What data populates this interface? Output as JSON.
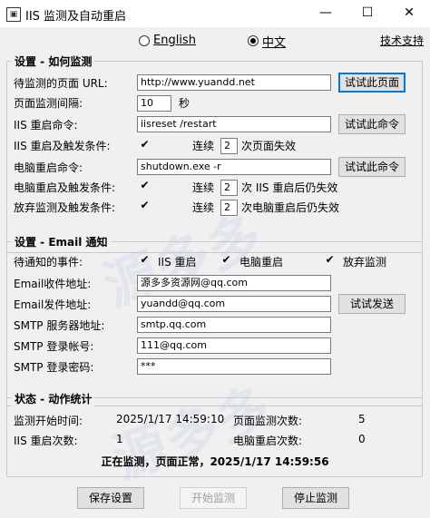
{
  "window": {
    "title": "IIS 监测及自动重启",
    "icon_name": "app-icon",
    "minimize_glyph": "—",
    "maximize_glyph": "☐",
    "close_glyph": "✕"
  },
  "language": {
    "english_label": "English",
    "chinese_label": "中文",
    "selected": "中文",
    "support_link": "技术支持"
  },
  "settings": {
    "title": "设置 - 如何监测",
    "url_label": "待监测的页面 URL:",
    "url_value": "http://www.yuandd.net",
    "test_page_button": "试试此页面",
    "interval_label": "页面监测间隔:",
    "interval_value": "10",
    "interval_unit": "秒",
    "iis_restart_label": "IIS 重启命令:",
    "iis_restart_value": "iisreset /restart",
    "test_command_button_1": "试试此命令",
    "iis_trigger_label": "IIS 重启及触发条件:",
    "iis_trigger_prefix": "连续",
    "iis_trigger_count": "2",
    "iis_trigger_suffix": "次页面失效",
    "pc_restart_label": "电脑重启命令:",
    "pc_restart_value": "shutdown.exe -r",
    "test_command_button_2": "试试此命令",
    "pc_trigger_label": "电脑重启及触发条件:",
    "pc_trigger_prefix": "连续",
    "pc_trigger_count": "2",
    "pc_trigger_suffix": "次 IIS 重启后仍失效",
    "abandon_label": "放弃监测及触发条件:",
    "abandon_prefix": "连续",
    "abandon_count": "2",
    "abandon_suffix": "次电脑重启后仍失效",
    "check_glyph": "✔"
  },
  "email": {
    "title": "设置 - Email 通知",
    "events_label": "待通知的事件:",
    "event_iis": "IIS 重启",
    "event_pc": "电脑重启",
    "event_abandon": "放弃监测",
    "to_label": "Email收件地址:",
    "to_value": "源多多资源网@qq.com",
    "from_label": "Email发件地址:",
    "from_value": "yuandd@qq.com",
    "test_send_button": "试试发送",
    "smtp_server_label": "SMTP 服务器地址:",
    "smtp_server_value": "smtp.qq.com",
    "smtp_user_label": "SMTP 登录帐号:",
    "smtp_user_value": "111@qq.com",
    "smtp_password_label": "SMTP 登录密码:",
    "smtp_password_value": "***"
  },
  "status": {
    "title": "状态 - 动作统计",
    "start_time_label": "监测开始时间:",
    "start_time_value": "2025/1/17 14:59:10",
    "page_checks_label": "页面监测次数:",
    "page_checks_value": "5",
    "iis_restarts_label": "IIS 重启次数:",
    "iis_restarts_value": "1",
    "pc_restarts_label": "电脑重启次数:",
    "pc_restarts_value": "0",
    "status_line": "正在监测，页面正常，2025/1/17 14:59:56"
  },
  "footer": {
    "save_button": "保存设置",
    "start_button": "开始监测",
    "stop_button": "停止监测"
  },
  "watermark": {
    "text": "源多多"
  }
}
